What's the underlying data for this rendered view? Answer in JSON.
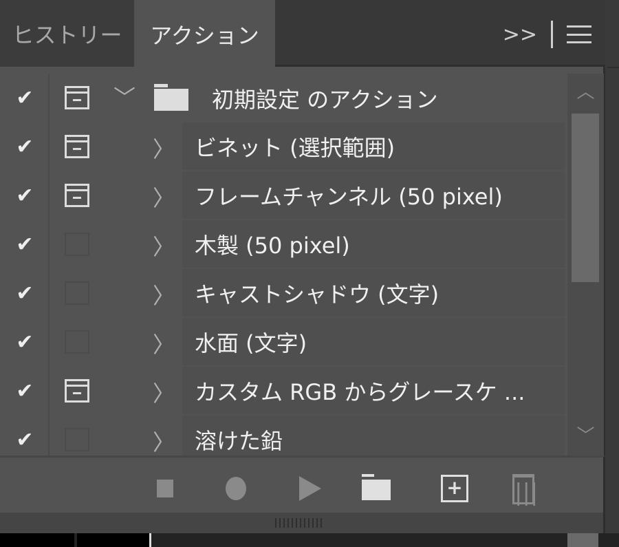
{
  "tabs": [
    {
      "label": "ヒストリー",
      "active": false
    },
    {
      "label": "アクション",
      "active": true
    }
  ],
  "tab_icons": {
    "expand": ">>"
  },
  "action_set": {
    "label": "初期設定 のアクション",
    "enabled": true,
    "dialog": true,
    "expanded": true
  },
  "actions": [
    {
      "label": "ビネット (選択範囲)",
      "enabled": true,
      "dialog": true
    },
    {
      "label": "フレームチャンネル (50 pixel)",
      "enabled": true,
      "dialog": true
    },
    {
      "label": "木製 (50 pixel)",
      "enabled": true,
      "dialog": false
    },
    {
      "label": "キャストシャドウ (文字)",
      "enabled": true,
      "dialog": false
    },
    {
      "label": "水面 (文字)",
      "enabled": true,
      "dialog": false
    },
    {
      "label": "カスタム RGB からグレースケ ...",
      "enabled": true,
      "dialog": true
    },
    {
      "label": "溶けた鉛",
      "enabled": true,
      "dialog": false
    }
  ],
  "glyphs": {
    "check": "✔",
    "chevron_right": "〉",
    "chevron_down": "﹀",
    "scroll_up": "︿",
    "scroll_down": "﹀",
    "plus": "+",
    "trash": "|||"
  }
}
